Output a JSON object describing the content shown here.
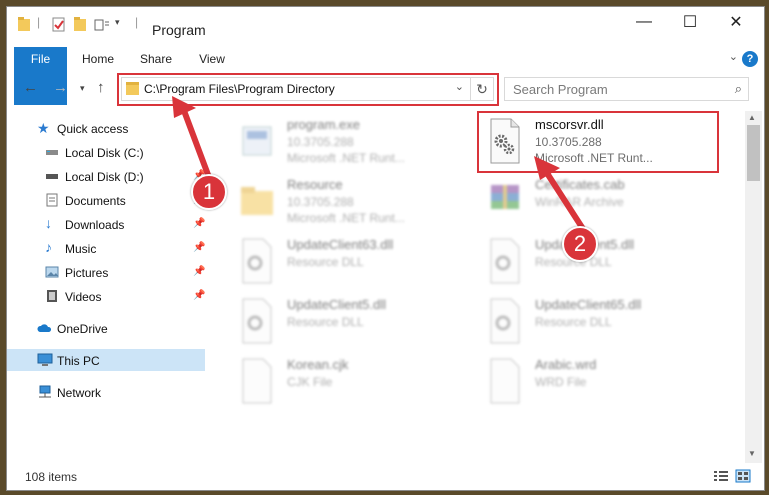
{
  "window": {
    "title": "Program",
    "controls": {
      "minimize": "—",
      "maximize": "☐",
      "close": "✕"
    }
  },
  "ribbon": {
    "tabs": [
      "File",
      "Home",
      "Share",
      "View"
    ],
    "help": "?"
  },
  "address": {
    "path": "C:\\Program Files\\Program Directory",
    "refresh": "↻"
  },
  "search": {
    "placeholder": "Search Program"
  },
  "sidebar": {
    "items": [
      {
        "label": "Quick access",
        "icon": "star-icon"
      },
      {
        "label": "Local Disk (C:)",
        "icon": "drive-icon"
      },
      {
        "label": "Local Disk (D:)",
        "icon": "drive-icon"
      },
      {
        "label": "Documents",
        "icon": "documents-icon"
      },
      {
        "label": "Downloads",
        "icon": "download-icon"
      },
      {
        "label": "Music",
        "icon": "music-icon"
      },
      {
        "label": "Pictures",
        "icon": "pictures-icon"
      },
      {
        "label": "Videos",
        "icon": "videos-icon"
      },
      {
        "label": "OneDrive",
        "icon": "cloud-icon"
      },
      {
        "label": "This PC",
        "icon": "computer-icon"
      },
      {
        "label": "Network",
        "icon": "network-icon"
      }
    ]
  },
  "files": [
    {
      "name": "program.exe",
      "line2": "10.3705.288",
      "line3": "Microsoft .NET Runt...",
      "icon": "exe-icon"
    },
    {
      "name": "mscorsvr.dll",
      "line2": "10.3705.288",
      "line3": "Microsoft .NET Runt...",
      "icon": "dll-gear-icon"
    },
    {
      "name": "Resource",
      "line2": "10.3705.288",
      "line3": "Microsoft .NET Runt...",
      "icon": "folder-icon"
    },
    {
      "name": "Certificates.cab",
      "line2": "WinRAR Archive",
      "line3": "",
      "icon": "archive-icon"
    },
    {
      "name": "UpdateClient63.dll",
      "line2": "Resource DLL",
      "line3": "",
      "icon": "dll-icon"
    },
    {
      "name": "UpdateClient5.dll",
      "line2": "Resource DLL",
      "line3": "",
      "icon": "dll-icon"
    },
    {
      "name": "UpdateClient5.dll",
      "line2": "Resource DLL",
      "line3": "",
      "icon": "dll-icon"
    },
    {
      "name": "UpdateClient65.dll",
      "line2": "Resource DLL",
      "line3": "",
      "icon": "dll-icon"
    },
    {
      "name": "Korean.cjk",
      "line2": "CJK File",
      "line3": "",
      "icon": "file-icon"
    },
    {
      "name": "Arabic.wrd",
      "line2": "WRD File",
      "line3": "",
      "icon": "file-icon"
    }
  ],
  "status": {
    "count": "108 items"
  },
  "callouts": [
    "1",
    "2"
  ],
  "colors": {
    "accent": "#1979ca",
    "highlight": "#d9343a",
    "selected": "#cce4f7"
  }
}
